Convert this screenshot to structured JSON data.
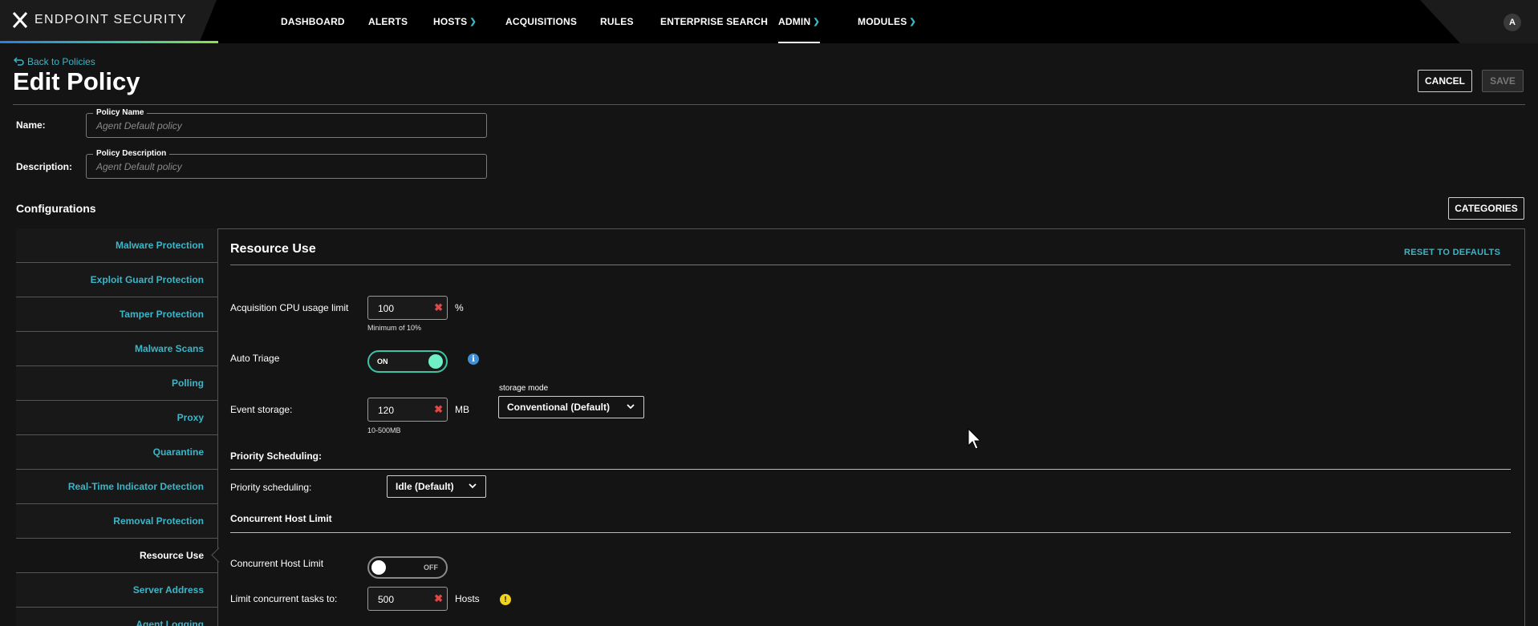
{
  "app": {
    "brand": "ENDPOINT SECURITY",
    "avatar_initial": "A"
  },
  "nav": [
    {
      "label": "DASHBOARD",
      "has_menu": false,
      "active": false
    },
    {
      "label": "ALERTS",
      "has_menu": false,
      "active": false
    },
    {
      "label": "HOSTS",
      "has_menu": true,
      "active": false
    },
    {
      "label": "ACQUISITIONS",
      "has_menu": false,
      "active": false
    },
    {
      "label": "RULES",
      "has_menu": false,
      "active": false
    },
    {
      "label": "ENTERPRISE SEARCH",
      "has_menu": false,
      "active": false
    },
    {
      "label": "ADMIN",
      "has_menu": true,
      "active": true
    },
    {
      "label": "MODULES",
      "has_menu": true,
      "active": false
    }
  ],
  "page": {
    "back_link": "Back to Policies",
    "title": "Edit Policy",
    "cancel_label": "CANCEL",
    "save_label": "SAVE"
  },
  "form": {
    "name_label": "Name:",
    "name_legend": "Policy Name",
    "name_placeholder": "Agent Default policy",
    "description_label": "Description:",
    "description_legend": "Policy Description",
    "description_placeholder": "Agent Default policy"
  },
  "configurations": {
    "title": "Configurations",
    "categories_label": "CATEGORIES",
    "sidebar": [
      {
        "label": "Malware Protection",
        "active": false
      },
      {
        "label": "Exploit Guard Protection",
        "active": false
      },
      {
        "label": "Tamper Protection",
        "active": false
      },
      {
        "label": "Malware Scans",
        "active": false
      },
      {
        "label": "Polling",
        "active": false
      },
      {
        "label": "Proxy",
        "active": false
      },
      {
        "label": "Quarantine",
        "active": false
      },
      {
        "label": "Real-Time Indicator Detection",
        "active": false
      },
      {
        "label": "Removal Protection",
        "active": false
      },
      {
        "label": "Resource Use",
        "active": true
      },
      {
        "label": "Server Address",
        "active": false
      },
      {
        "label": "Agent Logging",
        "active": false
      }
    ]
  },
  "resource_use": {
    "title": "Resource Use",
    "reset_label": "RESET TO DEFAULTS",
    "cpu_label": "Acquisition CPU usage limit",
    "cpu_value": "100",
    "cpu_unit": "%",
    "cpu_hint": "Minimum of 10%",
    "auto_triage_label": "Auto Triage",
    "auto_triage_state": "ON",
    "event_storage_label": "Event storage:",
    "event_storage_value": "120",
    "event_storage_unit": "MB",
    "event_storage_hint": "10-500MB",
    "storage_mode_legend": "storage mode",
    "storage_mode_value": "Conventional (Default)",
    "priority_heading": "Priority Scheduling:",
    "priority_label": "Priority scheduling:",
    "priority_value": "Idle (Default)",
    "concurrent_heading": "Concurrent Host Limit",
    "concurrent_toggle_label": "Concurrent Host Limit",
    "concurrent_toggle_state": "OFF",
    "limit_label": "Limit concurrent tasks to:",
    "limit_value": "500",
    "limit_unit": "Hosts"
  },
  "colors": {
    "accent": "#3bb6c9",
    "toggle_on": "#3ac3a5",
    "clear_x": "#e04848",
    "info": "#3d8fd6",
    "warning": "#f2d31b"
  }
}
